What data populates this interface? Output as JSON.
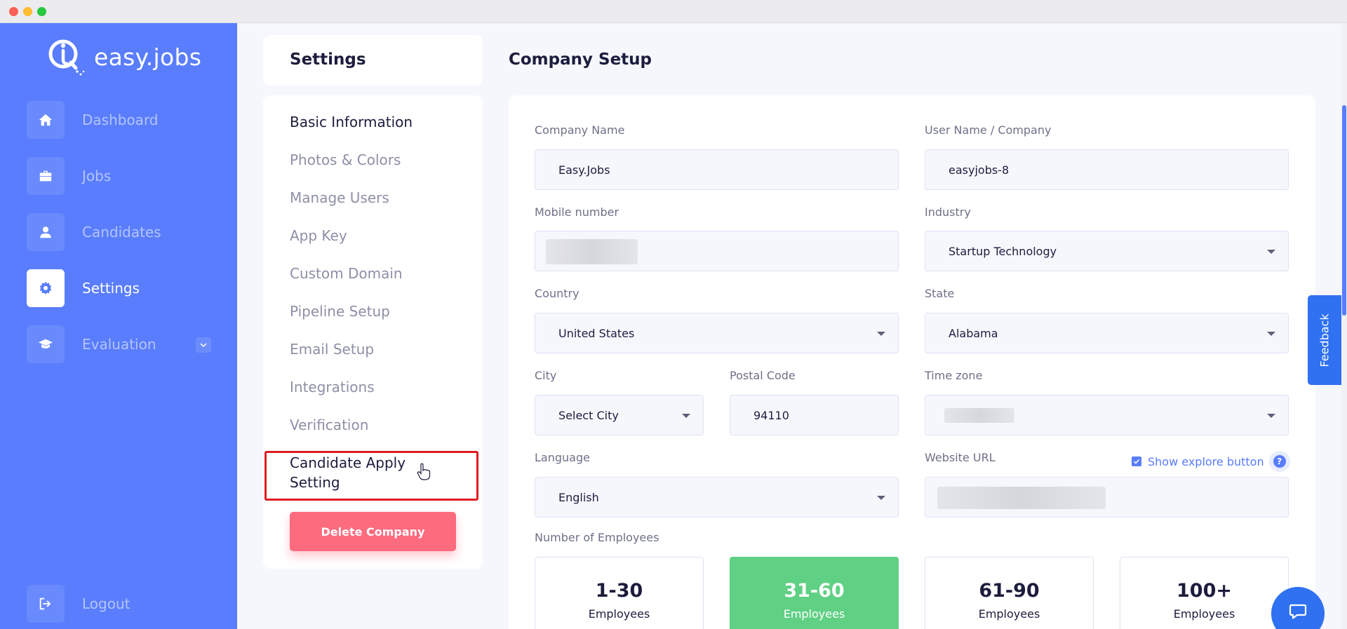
{
  "brand": {
    "name": "easy.jobs"
  },
  "nav": [
    {
      "label": "Dashboard",
      "icon": "home-icon"
    },
    {
      "label": "Jobs",
      "icon": "briefcase-icon"
    },
    {
      "label": "Candidates",
      "icon": "user-icon"
    },
    {
      "label": "Settings",
      "icon": "gear-icon",
      "active": true
    },
    {
      "label": "Evaluation",
      "icon": "graduation-cap-icon"
    }
  ],
  "logout": {
    "label": "Logout",
    "icon": "logout-icon"
  },
  "settings_menu": {
    "title": "Settings",
    "items": [
      "Basic Information",
      "Photos & Colors",
      "Manage Users",
      "App Key",
      "Custom Domain",
      "Pipeline Setup",
      "Email Setup",
      "Integrations",
      "Verification"
    ],
    "highlighted_item": "Candidate Apply Setting",
    "delete_button": "Delete Company"
  },
  "form": {
    "title": "Company Setup",
    "company_name": {
      "label": "Company Name",
      "value": "Easy.Jobs"
    },
    "user_name": {
      "label": "User Name / Company",
      "value": "easyjobs-8"
    },
    "mobile": {
      "label": "Mobile number"
    },
    "industry": {
      "label": "Industry",
      "value": "Startup Technology"
    },
    "country": {
      "label": "Country",
      "value": "United States"
    },
    "state": {
      "label": "State",
      "value": "Alabama"
    },
    "city": {
      "label": "City",
      "value": "Select City"
    },
    "postal_code": {
      "label": "Postal Code",
      "value": "94110"
    },
    "time_zone": {
      "label": "Time zone"
    },
    "language": {
      "label": "Language",
      "value": "English"
    },
    "website_url": {
      "label": "Website URL"
    },
    "show_explore": {
      "label": "Show explore button",
      "checked": true
    },
    "employees": {
      "label": "Number of Employees",
      "options": [
        {
          "range": "1-30",
          "unit": "Employees"
        },
        {
          "range": "31-60",
          "unit": "Employees",
          "selected": true
        },
        {
          "range": "61-90",
          "unit": "Employees"
        },
        {
          "range": "100+",
          "unit": "Employees"
        }
      ]
    }
  },
  "feedback": {
    "label": "Feedback"
  },
  "colors": {
    "primary": "#597dfc",
    "danger": "#fd6b7f",
    "success": "#60d084",
    "highlight": "#e01b22",
    "feedback": "#2f71f0"
  }
}
